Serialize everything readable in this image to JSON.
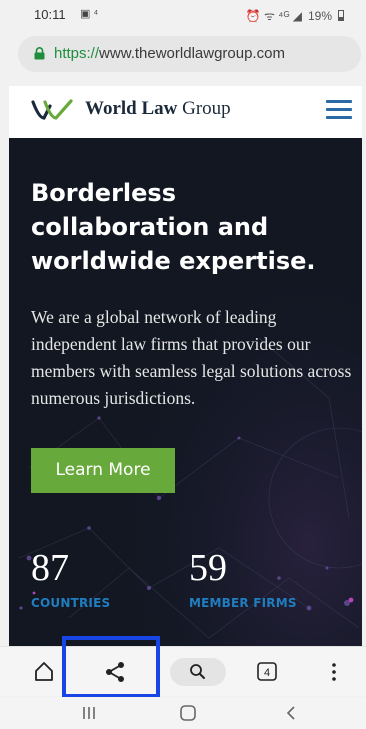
{
  "status_bar": {
    "time": "10:11",
    "notification_icons": "▣ ⁴",
    "signal_text": "⏰ ᯤ ⁴ᴳ ◢",
    "battery": "19%"
  },
  "browser": {
    "url_scheme": "https://",
    "url_rest": "www.theworldlawgroup.com"
  },
  "site": {
    "logo_text_bold": "World Law",
    "logo_text_regular": " Group"
  },
  "hero": {
    "title": "Borderless collaboration and worldwide expertise.",
    "body": "We are a global network of leading independent law firms that provides our members with seamless legal solutions across numerous jurisdictions.",
    "button_label": "Learn More",
    "stats": [
      {
        "number": "87",
        "label": "COUNTRIES"
      },
      {
        "number": "59",
        "label": "MEMBER FIRMS"
      }
    ]
  },
  "toolbar": {
    "tabs_count": "4",
    "icons": [
      "home-icon",
      "share-icon",
      "search-icon",
      "tabs-icon",
      "more-icon"
    ]
  },
  "colors": {
    "brand_navy": "#1b2a3a",
    "brand_green": "#68a93c",
    "accent_blue": "#1f7ec0",
    "hero_bg": "#121722",
    "highlight": "#1745e6",
    "secure_green": "#1e8e3e"
  }
}
